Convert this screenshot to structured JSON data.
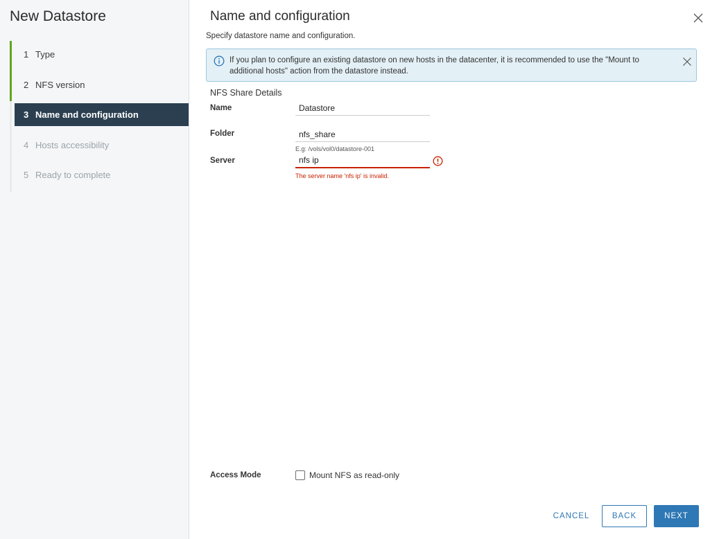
{
  "wizard": {
    "title": "New Datastore",
    "steps": [
      {
        "num": "1",
        "label": "Type",
        "state": "done"
      },
      {
        "num": "2",
        "label": "NFS version",
        "state": "done"
      },
      {
        "num": "3",
        "label": "Name and configuration",
        "state": "active"
      },
      {
        "num": "4",
        "label": "Hosts accessibility",
        "state": "pending"
      },
      {
        "num": "5",
        "label": "Ready to complete",
        "state": "pending"
      }
    ]
  },
  "page": {
    "title": "Name and configuration",
    "subtitle": "Specify datastore name and configuration.",
    "close_icon": "close-icon"
  },
  "alert": {
    "icon": "info-icon",
    "text": "If you plan to configure an existing datastore on new hosts in the datacenter, it is recommended to use the \"Mount to additional hosts\" action from the datastore instead."
  },
  "form": {
    "section_title": "NFS Share Details",
    "name": {
      "label": "Name",
      "value": "Datastore"
    },
    "folder": {
      "label": "Folder",
      "value": "nfs_share",
      "helper": "E.g: /vols/vol0/datastore-001"
    },
    "server": {
      "label": "Server",
      "value": "nfs ip",
      "error": "The server name 'nfs ip' is invalid."
    },
    "access_mode": {
      "label": "Access Mode",
      "checkbox_label": "Mount NFS as read-only",
      "checked": false
    }
  },
  "footer": {
    "cancel_label": "CANCEL",
    "back_label": "BACK",
    "next_label": "NEXT"
  },
  "colors": {
    "accent": "#2e78b5",
    "active_step_bg": "#2b3f50",
    "done_step": "#62a420",
    "error": "#c92100",
    "alert_bg": "#e3f0f6"
  }
}
